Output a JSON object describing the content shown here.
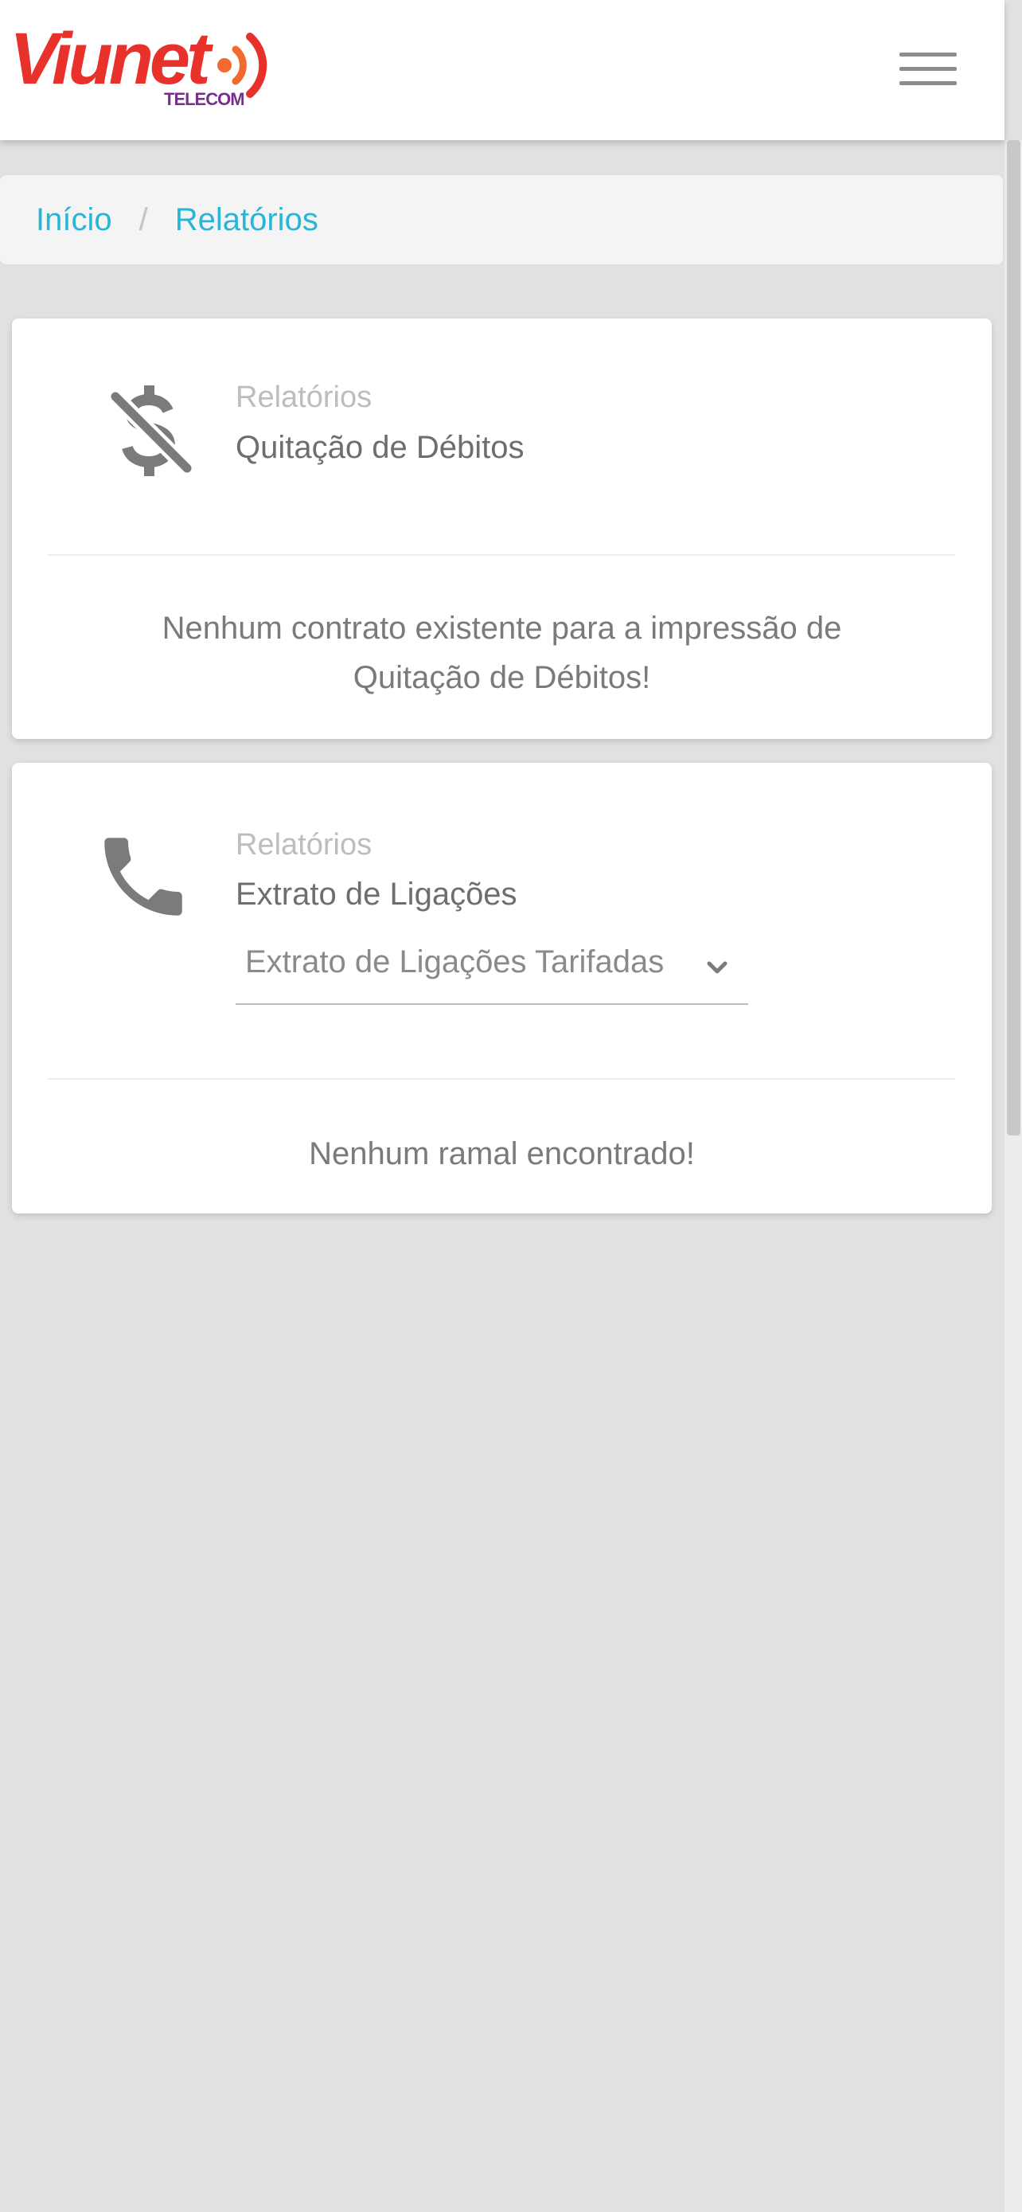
{
  "header": {
    "logo": {
      "word": "Viunet",
      "sub": "TELECOM"
    },
    "menu_icon": "hamburger-menu-icon"
  },
  "breadcrumb": {
    "items": [
      {
        "label": "Início"
      },
      {
        "label": "Relatórios"
      }
    ],
    "separator": "/"
  },
  "cards": [
    {
      "icon": "no-dollar-icon",
      "kicker": "Relatórios",
      "title": "Quitação de Débitos",
      "message": "Nenhum contrato existente para a impressão de Quitação de Débitos!"
    },
    {
      "icon": "phone-icon",
      "kicker": "Relatórios",
      "title": "Extrato de Ligações",
      "select": {
        "value": "Extrato de Ligações Tarifadas"
      },
      "message": "Nenhum ramal encontrado!"
    }
  ],
  "colors": {
    "link": "#29b6d6",
    "brand_red": "#e8312a",
    "brand_orange": "#f26a2e",
    "brand_purple": "#7a2e8c",
    "icon_gray": "#7b7b7b"
  }
}
